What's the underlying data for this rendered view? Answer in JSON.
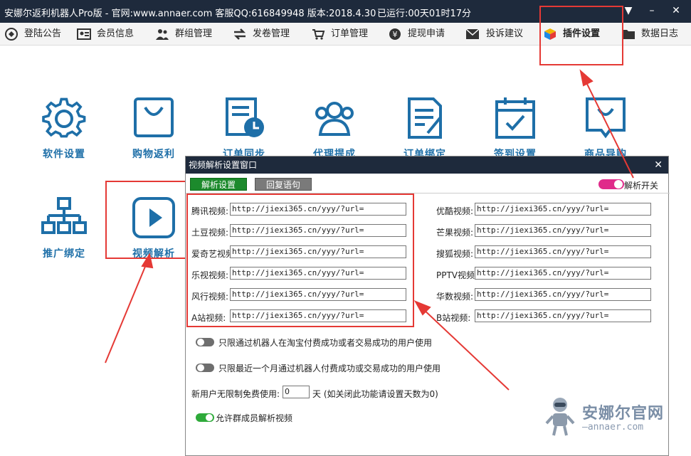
{
  "window": {
    "title": "安娜尔返利机器人Pro版 - 官网:www.annaer.com 客服QQ:616849948 版本:2018.4.30",
    "uptime": "已运行:00天01时17分"
  },
  "menu": [
    {
      "label": "登陆公告",
      "icon": "login-notice-icon"
    },
    {
      "label": "会员信息",
      "icon": "member-card-icon"
    },
    {
      "label": "群组管理",
      "icon": "group-icon"
    },
    {
      "label": "发卷管理",
      "icon": "transfer-icon"
    },
    {
      "label": "订单管理",
      "icon": "cart-icon"
    },
    {
      "label": "提现申请",
      "icon": "yen-icon"
    },
    {
      "label": "投诉建议",
      "icon": "mail-icon"
    },
    {
      "label": "插件设置",
      "icon": "plugin-cube-icon"
    },
    {
      "label": "数据日志",
      "icon": "folder-icon"
    }
  ],
  "apps": [
    {
      "label": "软件设置",
      "icon": "gear-icon"
    },
    {
      "label": "购物返利",
      "icon": "shopping-bag-icon"
    },
    {
      "label": "订单同步",
      "icon": "order-sync-icon"
    },
    {
      "label": "代理提成",
      "icon": "users-icon"
    },
    {
      "label": "订单绑定",
      "icon": "document-edit-icon"
    },
    {
      "label": "签到设置",
      "icon": "calendar-check-icon"
    },
    {
      "label": "商品导购",
      "icon": "chat-bag-icon"
    },
    {
      "label": "推广绑定",
      "icon": "org-chart-icon"
    },
    {
      "label": "视频解析",
      "icon": "play-icon"
    }
  ],
  "dialog": {
    "title": "视频解析设置窗口",
    "tabs": [
      "解析设置",
      "回复语句"
    ],
    "switch_label": "解析开关",
    "left_fields": [
      {
        "label": "腾讯视频:",
        "value": "http://jiexi365.cn/yyy/?url="
      },
      {
        "label": "土豆视频:",
        "value": "http://jiexi365.cn/yyy/?url="
      },
      {
        "label": "爱奇艺视频:",
        "value": "http://jiexi365.cn/yyy/?url="
      },
      {
        "label": "乐视视频:",
        "value": "http://jiexi365.cn/yyy/?url="
      },
      {
        "label": "风行视频:",
        "value": "http://jiexi365.cn/yyy/?url="
      },
      {
        "label": "A站视频:",
        "value": "http://jiexi365.cn/yyy/?url="
      }
    ],
    "right_fields": [
      {
        "label": "优酷视频:",
        "value": "http://jiexi365.cn/yyy/?url="
      },
      {
        "label": "芒果视频:",
        "value": "http://jiexi365.cn/yyy/?url="
      },
      {
        "label": "搜狐视频:",
        "value": "http://jiexi365.cn/yyy/?url="
      },
      {
        "label": "PPTV视频:",
        "value": "http://jiexi365.cn/yyy/?url="
      },
      {
        "label": "华数视频:",
        "value": "http://jiexi365.cn/yyy/?url="
      },
      {
        "label": "B站视频:",
        "value": "http://jiexi365.cn/yyy/?url="
      }
    ],
    "option1": "只限通过机器人在淘宝付费成功或者交易成功的用户使用",
    "option2": "只限最近一个月通过机器人付费成功或交易成功的用户使用",
    "free_label": "新用户无限制免费使用:",
    "free_value": "0",
    "free_unit": "天 (如关闭此功能请设置天数为0)",
    "option3": "允许群成员解析视频"
  },
  "watermark": {
    "title": "安娜尔官网",
    "sub": "—annaer.com"
  },
  "colors": {
    "titlebar": "#1e2a3c",
    "app_icon": "#1e6fa8",
    "accent_red": "#e53935",
    "tab_active": "#1c8a2c",
    "switch_on": "#e02a8a"
  }
}
